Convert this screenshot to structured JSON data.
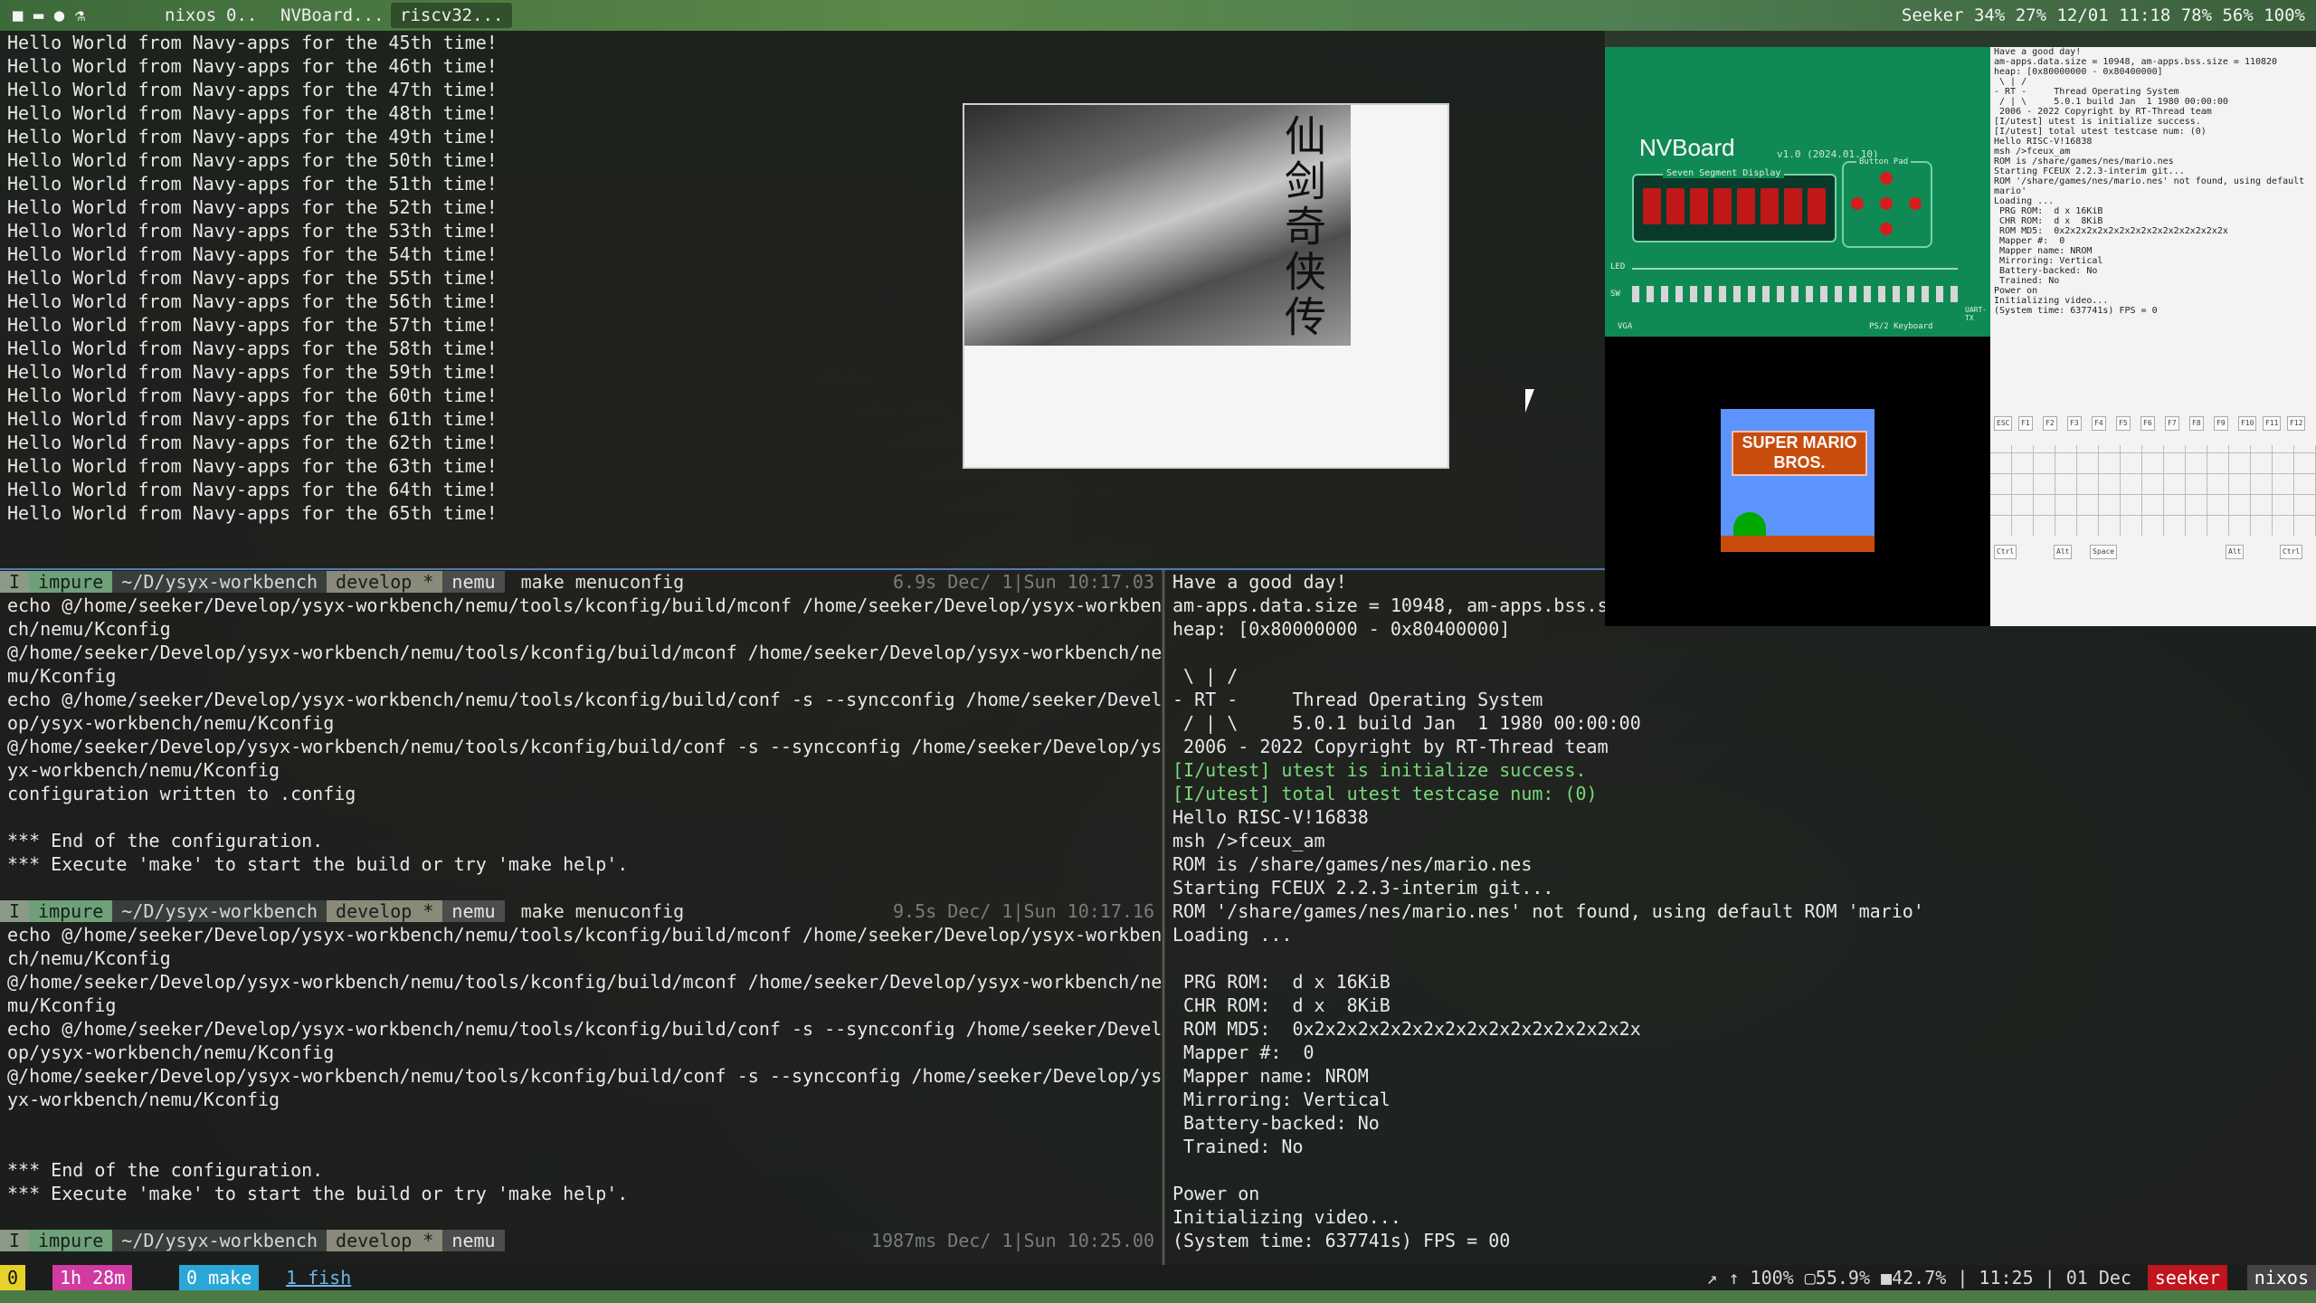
{
  "topbar": {
    "workspaces": [
      "nixos",
      "0..",
      "NVBoard...",
      "riscv32..."
    ],
    "status": "Seeker  34%  27%  12/01 11:18  78%  56%  100%"
  },
  "top_terminal": {
    "lines": [
      "Hello World from Navy-apps for the 45th time!",
      "Hello World from Navy-apps for the 46th time!",
      "Hello World from Navy-apps for the 47th time!",
      "Hello World from Navy-apps for the 48th time!",
      "Hello World from Navy-apps for the 49th time!",
      "Hello World from Navy-apps for the 50th time!",
      "Hello World from Navy-apps for the 51th time!",
      "Hello World from Navy-apps for the 52th time!",
      "Hello World from Navy-apps for the 53th time!",
      "Hello World from Navy-apps for the 54th time!",
      "Hello World from Navy-apps for the 55th time!",
      "Hello World from Navy-apps for the 56th time!",
      "Hello World from Navy-apps for the 57th time!",
      "Hello World from Navy-apps for the 58th time!",
      "Hello World from Navy-apps for the 59th time!",
      "Hello World from Navy-apps for the 60th time!",
      "Hello World from Navy-apps for the 61th time!",
      "Hello World from Navy-apps for the 62th time!",
      "Hello World from Navy-apps for the 63th time!",
      "Hello World from Navy-apps for the 64th time!",
      "Hello World from Navy-apps for the 65th time!"
    ]
  },
  "image_window": {
    "title_glyphs": "仙剑奇侠传"
  },
  "prompt": {
    "mode": "I",
    "host": "impure",
    "path": "~/D/ysyx-workbench",
    "branch": "develop *",
    "dir": "nemu"
  },
  "left_terminal": {
    "block1": {
      "command": "make menuconfig",
      "right_status": "6.9s  Dec/ 1|Sun 10:17.03",
      "lines": [
        "echo @/home/seeker/Develop/ysyx-workbench/nemu/tools/kconfig/build/mconf /home/seeker/Develop/ysyx-workben",
        "ch/nemu/Kconfig",
        "@/home/seeker/Develop/ysyx-workbench/nemu/tools/kconfig/build/mconf /home/seeker/Develop/ysyx-workbench/ne",
        "mu/Kconfig",
        "echo @/home/seeker/Develop/ysyx-workbench/nemu/tools/kconfig/build/conf -s --syncconfig /home/seeker/Devel",
        "op/ysyx-workbench/nemu/Kconfig",
        "@/home/seeker/Develop/ysyx-workbench/nemu/tools/kconfig/build/conf -s --syncconfig /home/seeker/Develop/ys",
        "yx-workbench/nemu/Kconfig",
        "configuration written to .config",
        "",
        "*** End of the configuration.",
        "*** Execute 'make' to start the build or try 'make help'.",
        ""
      ]
    },
    "block2": {
      "command": "make menuconfig",
      "right_status": "9.5s  Dec/ 1|Sun 10:17.16",
      "lines": [
        "echo @/home/seeker/Develop/ysyx-workbench/nemu/tools/kconfig/build/mconf /home/seeker/Develop/ysyx-workben",
        "ch/nemu/Kconfig",
        "@/home/seeker/Develop/ysyx-workbench/nemu/tools/kconfig/build/mconf /home/seeker/Develop/ysyx-workbench/ne",
        "mu/Kconfig",
        "echo @/home/seeker/Develop/ysyx-workbench/nemu/tools/kconfig/build/conf -s --syncconfig /home/seeker/Devel",
        "op/ysyx-workbench/nemu/Kconfig",
        "@/home/seeker/Develop/ysyx-workbench/nemu/tools/kconfig/build/conf -s --syncconfig /home/seeker/Develop/ys",
        "yx-workbench/nemu/Kconfig",
        "",
        "",
        "*** End of the configuration.",
        "*** Execute 'make' to start the build or try 'make help'.",
        ""
      ]
    },
    "block3": {
      "command": "",
      "right_status": "1987ms  Dec/ 1|Sun 10:25.00"
    }
  },
  "right_terminal": {
    "lines": [
      "Have a good day!",
      "am-apps.data.size = 10948, am-apps.bss.s",
      "heap: [0x80000000 - 0x80400000]",
      "",
      " \\ | /",
      "- RT -     Thread Operating System",
      " / | \\     5.0.1 build Jan  1 1980 00:00:00",
      " 2006 - 2022 Copyright by RT-Thread team",
      "[I/utest] utest is initialize success.",
      "[I/utest] total utest testcase num: (0)",
      "Hello RISC-V!16838",
      "msh />fceux_am",
      "ROM is /share/games/nes/mario.nes",
      "Starting FCEUX 2.2.3-interim git...",
      "ROM '/share/games/nes/mario.nes' not found, using default ROM 'mario'",
      "Loading ...",
      "",
      " PRG ROM:  d x 16KiB",
      " CHR ROM:  d x  8KiB",
      " ROM MD5:  0x2x2x2x2x2x2x2x2x2x2x2x2x2x2x2x",
      " Mapper #:  0",
      " Mapper name: NROM",
      " Mirroring: Vertical",
      " Battery-backed: No",
      " Trained: No",
      "",
      "Power on",
      "Initializing video...",
      "(System time: 637741s) FPS = 00"
    ]
  },
  "nvboard": {
    "title": "NVBoard",
    "version": "v1.0 (2024.01.10)",
    "seg_label": "Seven Segment Display",
    "btnpad_label": "Button Pad",
    "led_label": "LED",
    "sw_label": "SW",
    "vga_label": "VGA",
    "ps2_label": "PS/2 Keyboard",
    "uart_label": "UART-TX",
    "mario_logo": "SUPER MARIO BROS."
  },
  "mini_terminal": {
    "lines": [
      "Have a good day!",
      "am-apps.data.size = 10948, am-apps.bss.size = 110820",
      "heap: [0x80000000 - 0x80400000]",
      "",
      " \\ | /",
      "- RT -     Thread Operating System",
      " / | \\     5.0.1 build Jan  1 1980 00:00:00",
      " 2006 - 2022 Copyright by RT-Thread team",
      "[I/utest] utest is initialize success.",
      "[I/utest] total utest testcase num: (0)",
      "Hello RISC-V!16838",
      "msh />fceux_am",
      "ROM is /share/games/nes/mario.nes",
      "Starting FCEUX 2.2.3-interim git...",
      "ROM '/share/games/nes/mario.nes' not found, using default",
      "mario'",
      "Loading ...",
      "",
      " PRG ROM:  d x 16KiB",
      " CHR ROM:  d x  8KiB",
      " ROM MD5:  0x2x2x2x2x2x2x2x2x2x2x2x2x2x2x2x",
      " Mapper #:  0",
      " Mapper name: NROM",
      " Mirroring: Vertical",
      " Battery-backed: No",
      " Trained: No",
      "",
      "Power on",
      "Initializing video...",
      "(System time: 637741s) FPS = 0"
    ],
    "keys_row1": [
      "ESC",
      "F1",
      "F2",
      "F3",
      "F4",
      "F5",
      "F6",
      "F7",
      "F8",
      "F9",
      "F10",
      "F11",
      "F12"
    ],
    "keys_bottom": [
      "Ctrl",
      "Alt",
      "Space",
      "Alt",
      "Ctrl"
    ]
  },
  "statusbar": {
    "left": [
      "0",
      "1h 28m",
      "0 make",
      "1 fish"
    ],
    "right_info": "↗ ↑ 100%  ▢55.9% ■42.7% | 11:25 | 01 Dec",
    "user": "seeker",
    "host": "nixos"
  }
}
